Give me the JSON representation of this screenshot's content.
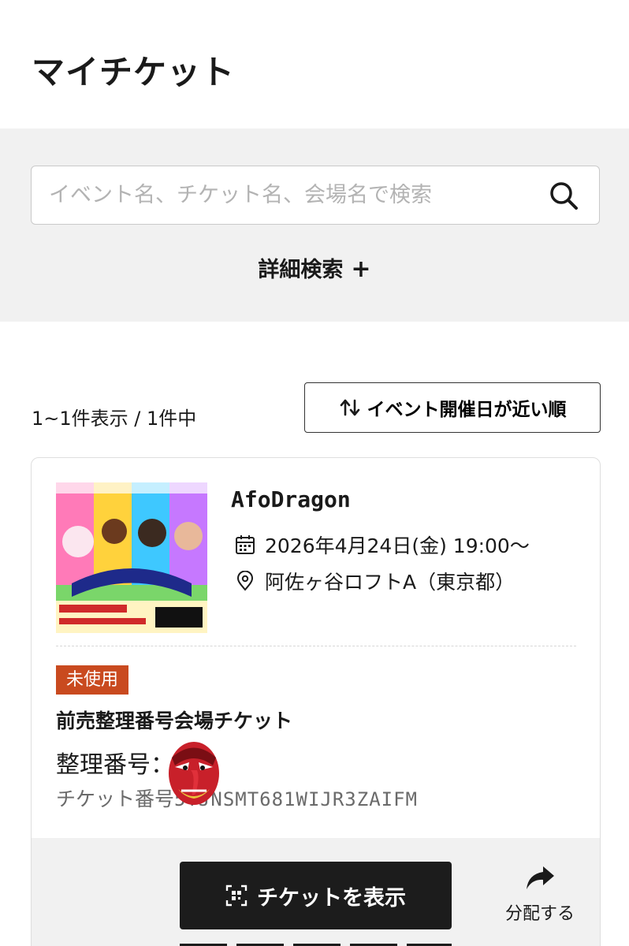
{
  "header": {
    "title": "マイチケット"
  },
  "search": {
    "placeholder": "イベント名、チケット名、会場名で検索",
    "advanced_label": "詳細検索",
    "advanced_plus": "+"
  },
  "results": {
    "count_label": "1~1件表示 / 1件中",
    "sort_label": "イベント開催日が近い順"
  },
  "ticket": {
    "event_title": "AfoDragon",
    "date": "2026年4月24日(金) 19:00〜",
    "venue": "阿佐ヶ谷ロフトA（東京都）",
    "status": "未使用",
    "name": "前売整理番号会場チケット",
    "seat_label": "整理番号：",
    "number_label": "チケット番号",
    "number_code": "5TJNSMT681WIJR3ZAIFM",
    "show_button_label": "チケットを表示",
    "share_label": "分配する"
  },
  "colors": {
    "badge": "#c94a1f",
    "button": "#1c1c1c",
    "panel": "#f1f1f1"
  },
  "icons": [
    "search-icon",
    "sort-icon",
    "calendar-icon",
    "location-pin-icon",
    "qr-code-icon",
    "share-arrow-icon"
  ]
}
